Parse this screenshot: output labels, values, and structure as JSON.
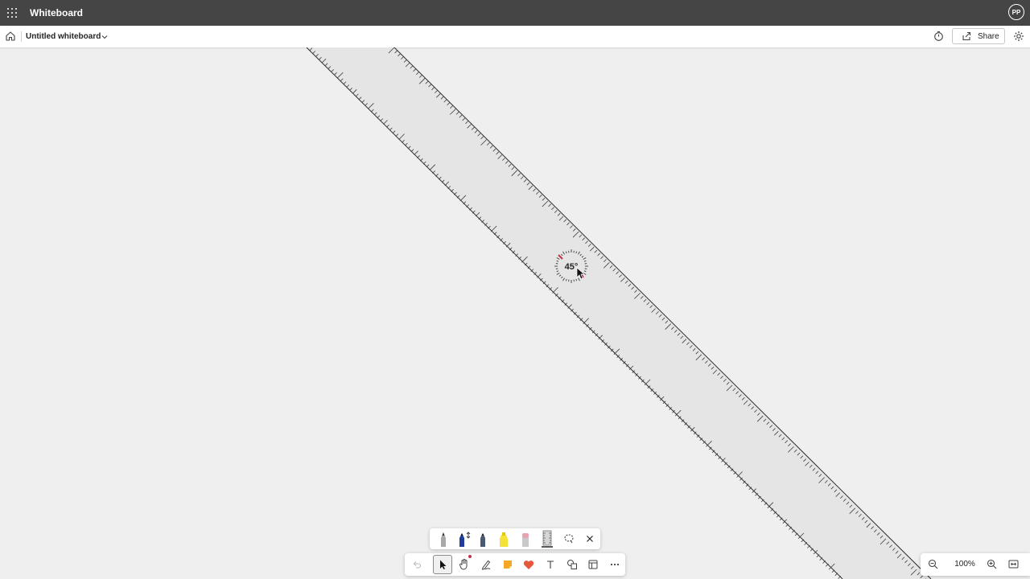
{
  "app": {
    "title": "Whiteboard",
    "user_initials": "PP"
  },
  "header": {
    "board_title": "Untitled whiteboard",
    "share_label": "Share"
  },
  "ruler": {
    "angle_label": "45°",
    "angle_degrees": 45
  },
  "zoom": {
    "level": "100%"
  },
  "colors": {
    "accent": "#c4314b",
    "topbar": "#464545",
    "canvas": "#efefef",
    "ruler": "#e5e5e5"
  },
  "pen_tray": [
    "pencil-icon",
    "blue-pen-icon",
    "gray-pen-icon",
    "highlighter-icon",
    "eraser-icon",
    "ruler-icon",
    "lasso-select-icon",
    "close-icon"
  ],
  "main_tools": [
    "undo-icon",
    "select-icon",
    "hand-icon",
    "inking-icon",
    "sticky-note-icon",
    "reaction-heart-icon",
    "text-icon",
    "shapes-icon",
    "templates-icon",
    "more-icon"
  ]
}
